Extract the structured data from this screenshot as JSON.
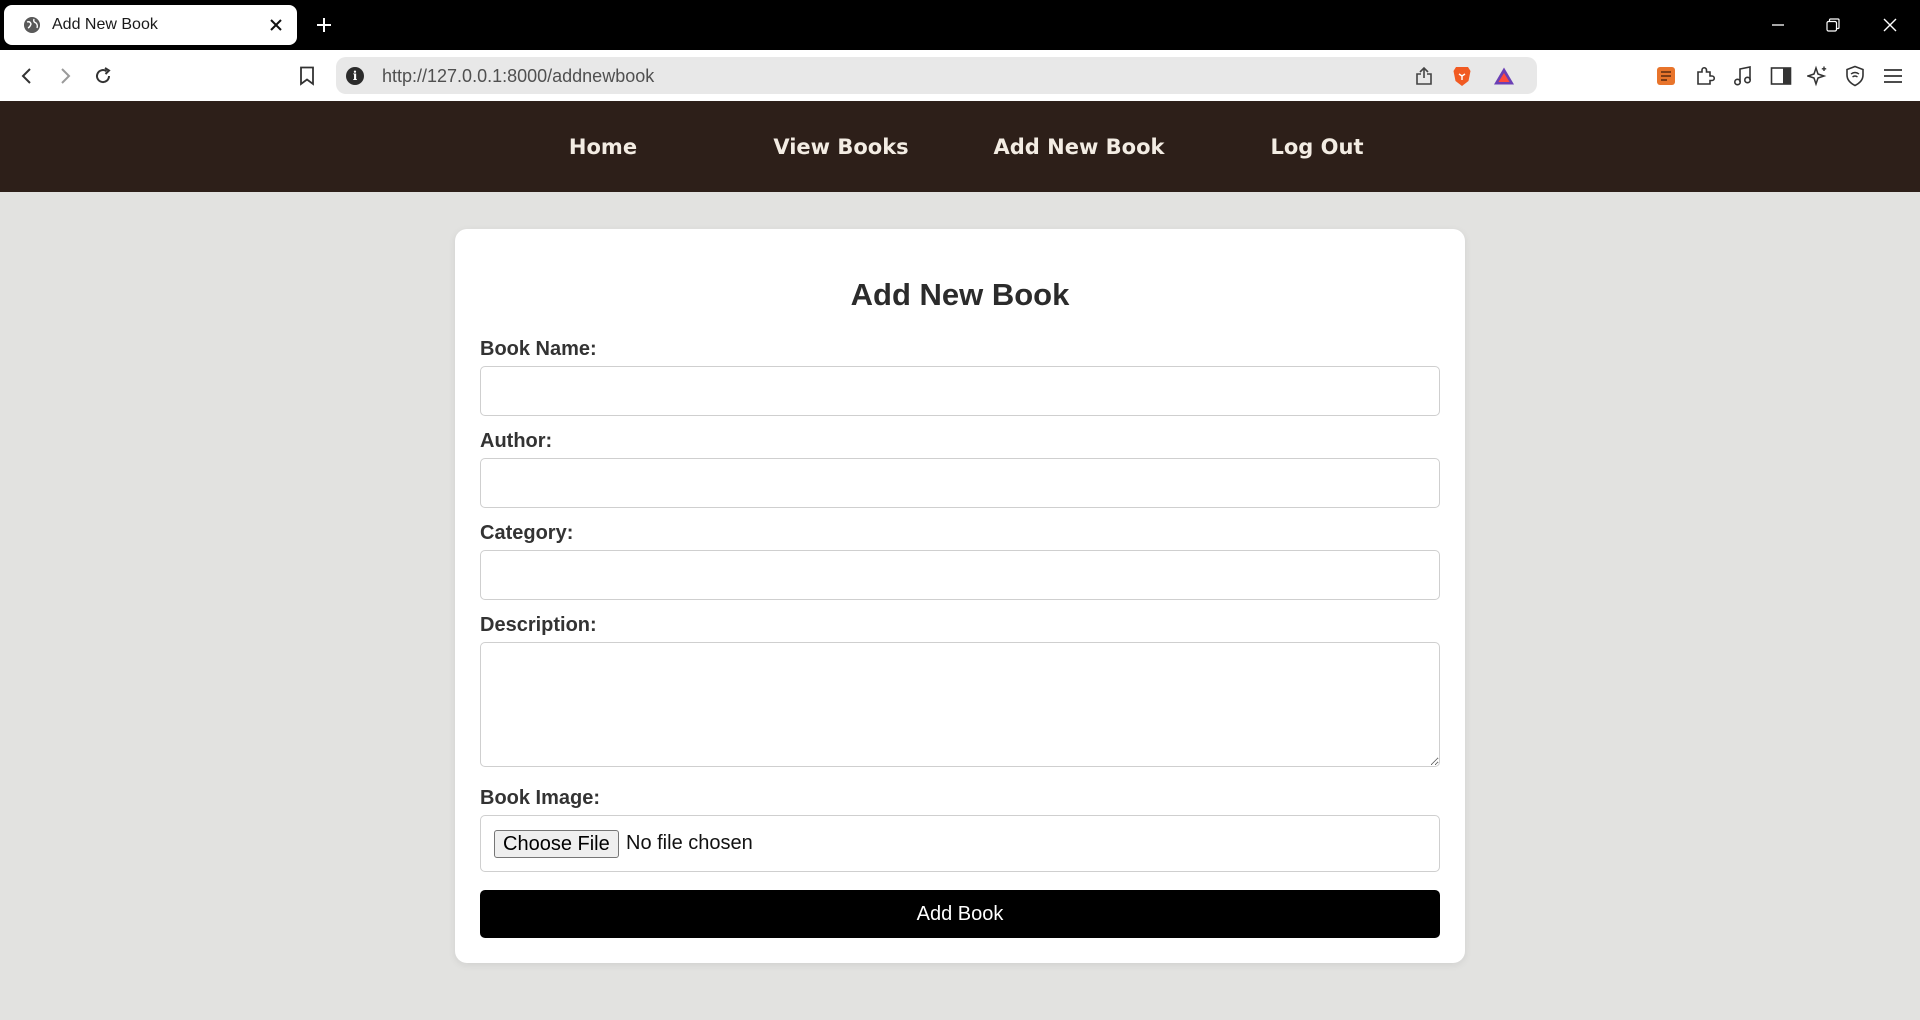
{
  "browser": {
    "tab_title": "Add New Book",
    "url": "http://127.0.0.1:8000/addnewbook",
    "icons": {
      "tab_favicon": "globe-icon",
      "tab_close": "close-icon",
      "new_tab": "plus-icon",
      "minimize": "minimize-icon",
      "restore": "restore-icon",
      "window_close": "close-icon",
      "back": "back-arrow-icon",
      "forward": "forward-arrow-icon",
      "reload": "reload-icon",
      "bookmark": "bookmark-icon",
      "site_info": "info-icon",
      "share": "share-icon",
      "brave_shields": "brave-lion-icon",
      "brave_rewards": "rewards-triangle-icon",
      "extensions": [
        "notes-extension-icon",
        "puzzle-icon",
        "music-icon",
        "sidebar-icon",
        "leo-ai-icon",
        "vpn-shield-icon",
        "menu-icon"
      ]
    }
  },
  "nav": {
    "home": "Home",
    "view_books": "View Books",
    "add_new_book": "Add New Book",
    "log_out": "Log Out"
  },
  "form": {
    "title": "Add New Book",
    "book_name_label": "Book Name:",
    "book_name_value": "",
    "author_label": "Author:",
    "author_value": "",
    "category_label": "Category:",
    "category_value": "",
    "description_label": "Description:",
    "description_value": "",
    "image_label": "Book Image:",
    "file_button": "Choose File",
    "file_status": "No file chosen",
    "submit": "Add Book"
  },
  "colors": {
    "nav_background": "#2d1f19",
    "page_background": "#e2e2e0",
    "submit_background": "#000000"
  }
}
